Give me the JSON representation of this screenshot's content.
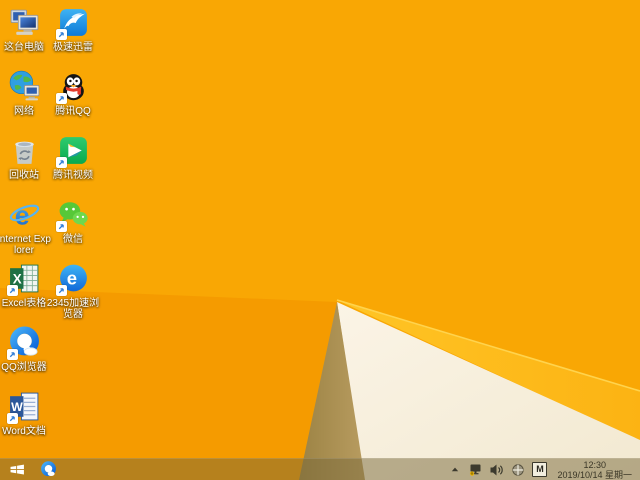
{
  "desktop": {
    "icons": [
      {
        "name": "this-pc",
        "label": "这台电脑",
        "shortcut": false
      },
      {
        "name": "xunlei-speed",
        "label": "极速迅雷",
        "shortcut": true
      },
      {
        "name": "network",
        "label": "网络",
        "shortcut": false
      },
      {
        "name": "tencent-qq",
        "label": "腾讯QQ",
        "shortcut": true
      },
      {
        "name": "recycle-bin",
        "label": "回收站",
        "shortcut": false
      },
      {
        "name": "tencent-video",
        "label": "腾讯视频",
        "shortcut": true
      },
      {
        "name": "internet-explorer",
        "label": "Internet Explorer",
        "shortcut": false
      },
      {
        "name": "wechat",
        "label": "微信",
        "shortcut": true
      },
      {
        "name": "excel",
        "label": "Excel表格",
        "shortcut": true
      },
      {
        "name": "browser-2345",
        "label": "2345加速浏览器",
        "shortcut": true
      },
      {
        "name": "qq-browser",
        "label": "QQ浏览器",
        "shortcut": true
      },
      {
        "name": "word",
        "label": "Word文档",
        "shortcut": true
      }
    ],
    "colors": {
      "wallpaper_orange": "#F9A704",
      "wallpaper_orange_deep": "#F59B00",
      "fold_khaki": "#A98E52",
      "sheet_cream": "#F7EFDB",
      "edge_yellow": "#FDB813"
    }
  },
  "taskbar": {
    "pinned": [
      {
        "name": "qq-browser"
      }
    ],
    "tray": {
      "input_method_label": "M"
    },
    "clock": {
      "time": "12:30",
      "date": "2019/10/14 星期一"
    }
  }
}
